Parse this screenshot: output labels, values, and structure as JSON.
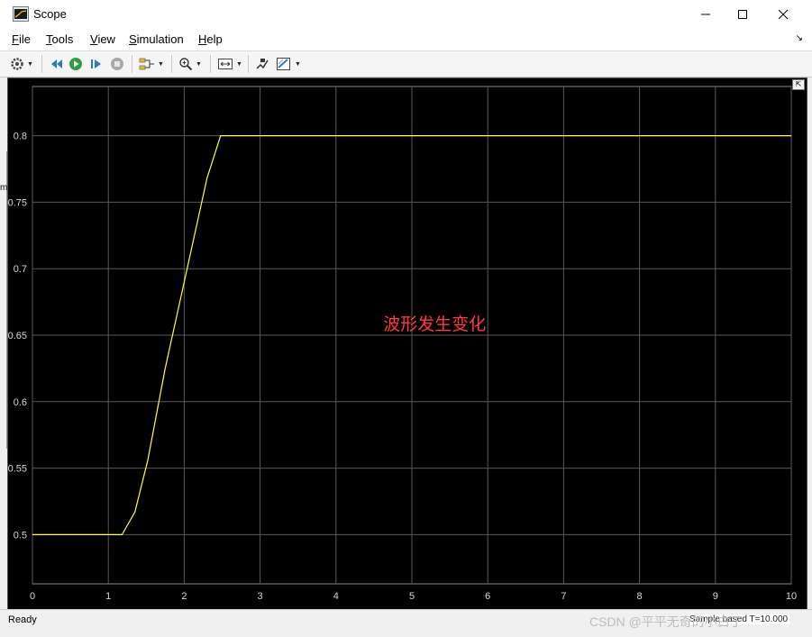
{
  "window": {
    "title": "Scope",
    "icon": "matlab-scope-icon"
  },
  "menu": [
    {
      "label": "File",
      "key": "F",
      "rest": "ile"
    },
    {
      "label": "Tools",
      "key": "T",
      "rest": "ools"
    },
    {
      "label": "View",
      "key": "V",
      "rest": "iew"
    },
    {
      "label": "Simulation",
      "key": "S",
      "rest": "imulation"
    },
    {
      "label": "Help",
      "key": "H",
      "rest": "elp"
    }
  ],
  "menu_arrow": "↘",
  "toolbar": {
    "icons": [
      "settings-gear-icon",
      "step-back-icon",
      "run-icon",
      "step-forward-icon",
      "stop-icon",
      "signal-selector-icon",
      "zoom-in-icon",
      "autoscale-icon",
      "highlight-icon",
      "style-icon"
    ]
  },
  "plot": {
    "annotation": "波形发生变化",
    "annotation_color": "#ff3b3b",
    "background": "#000000",
    "grid_color": "#5a5a5a",
    "line_color": "#ffff33"
  },
  "chart_data": {
    "type": "line",
    "title": "",
    "xlabel": "",
    "ylabel": "",
    "xlim": [
      0,
      10
    ],
    "ylim": [
      0.463,
      0.837
    ],
    "xticks": [
      0,
      1,
      2,
      3,
      4,
      5,
      6,
      7,
      8,
      9,
      10
    ],
    "yticks": [
      0.5,
      0.55,
      0.6,
      0.65,
      0.7,
      0.75,
      0.8
    ],
    "ytick_labels": [
      "0.5",
      "0.55",
      "0.6",
      "0.65",
      "0.7",
      "0.75",
      "0.8"
    ],
    "grid": true,
    "series": [
      {
        "x": [
          0,
          1.18,
          1.35,
          1.52,
          1.75,
          2.0,
          2.3,
          2.48,
          10
        ],
        "y": [
          0.5,
          0.5,
          0.517,
          0.556,
          0.625,
          0.69,
          0.768,
          0.8,
          0.8
        ]
      }
    ]
  },
  "status": {
    "text": "Ready",
    "right_text": "Sample based  T=10.000"
  },
  "watermark": "CSDN @平平无奇的小白丁",
  "edge_fragment": "m"
}
